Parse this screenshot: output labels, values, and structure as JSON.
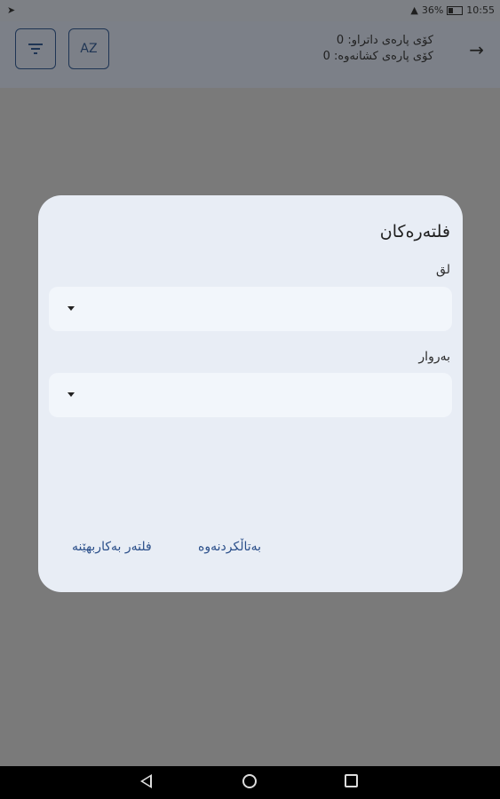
{
  "status_bar": {
    "battery": "36%",
    "time": "10:55"
  },
  "app_bar": {
    "sort_label": "AZ",
    "total_received": "کۆی پارەی داتراو: 0",
    "total_withdrawn": "کۆی پارەی کشانەوە: 0"
  },
  "dialog": {
    "title": "فلتەرەکان",
    "branch_label": "لق",
    "date_label": "بەروار",
    "apply_label": "فلتەر بەکاربهێنە",
    "cancel_label": "بەتاڵکردنەوە"
  }
}
